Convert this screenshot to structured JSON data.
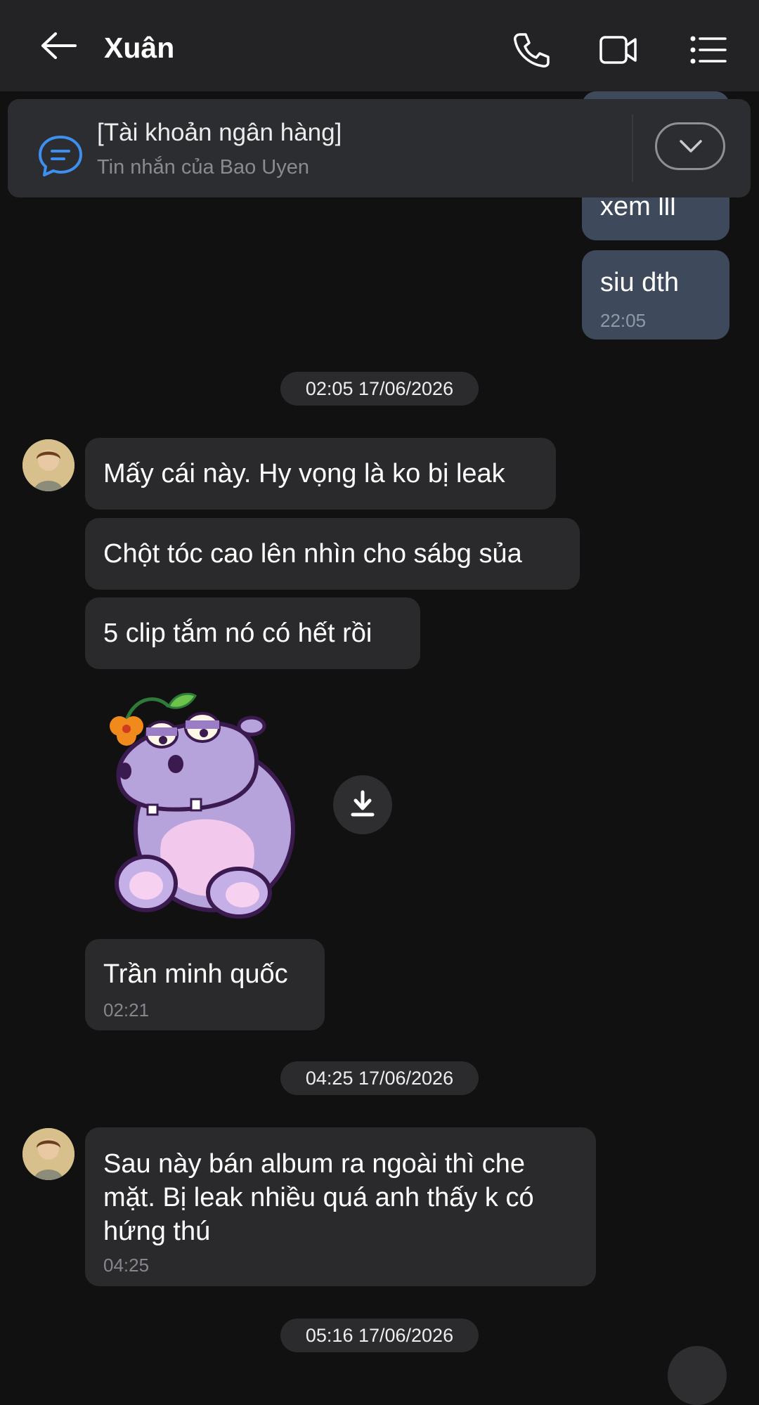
{
  "header": {
    "title": "Xuân",
    "back_icon": "arrow-left-icon",
    "actions": [
      "phone-icon",
      "video-icon",
      "menu-list-icon"
    ]
  },
  "pinned": {
    "title": "[Tài khoản ngân hàng]",
    "subtitle": "Tin nhắn của Bao Uyen",
    "icon": "chat-bubble-icon",
    "toggle_icon": "chevron-down-icon"
  },
  "messages_out": [
    {
      "text": "xem lll"
    },
    {
      "text": "siu dth",
      "time": "22:05"
    }
  ],
  "dates": [
    "02:05 17/06/2026",
    "04:25 17/06/2026",
    "05:16 17/06/2026"
  ],
  "group1": {
    "messages": [
      {
        "text": "Mấy cái này. Hy vọng là ko bị leak"
      },
      {
        "text": "Chột tóc cao lên nhìn cho sábg sủa"
      },
      {
        "text": "5 clip tắm nó có hết rồi"
      }
    ],
    "sticker": "purple-hippo-sticker",
    "last": {
      "text": "Trần minh quốc",
      "time": "02:21"
    }
  },
  "group2": {
    "message": {
      "lines": [
        "Sau này bán album ra ngoài thì che",
        "mặt. Bị leak nhiều quá anh thấy k có",
        "hứng thú"
      ],
      "time": "04:25"
    }
  },
  "colors": {
    "background": "#111112",
    "header": "#232325",
    "bubble_out": "#3e4a5c",
    "bubble_in": "#2a2a2c",
    "accent_blue": "#3d8ff0"
  }
}
